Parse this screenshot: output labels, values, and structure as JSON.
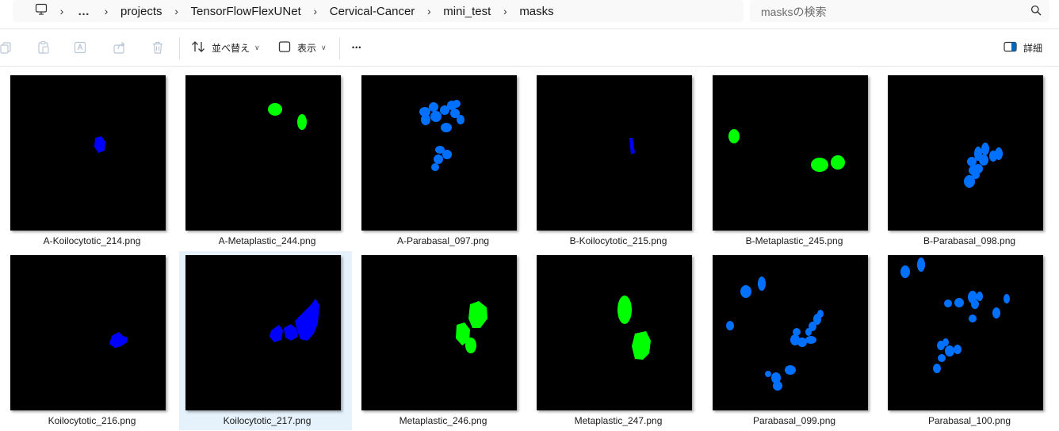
{
  "breadcrumb": {
    "overflow": "…",
    "segments": [
      "projects",
      "TensorFlowFlexUNet",
      "Cervical-Cancer",
      "mini_test",
      "masks"
    ]
  },
  "search": {
    "placeholder": "masksの検索"
  },
  "toolbar": {
    "sort_label": "並べ替え",
    "view_label": "表示",
    "more_label": "•••",
    "details_label": "詳細"
  },
  "colors": {
    "dark_blue": "#0000ff",
    "light_blue": "#0070ff",
    "green": "#00ff00",
    "selection": "#e5f1fb"
  },
  "files": [
    {
      "name": "A-Koilocytotic_214.png"
    },
    {
      "name": "A-Metaplastic_244.png"
    },
    {
      "name": "A-Parabasal_097.png"
    },
    {
      "name": "B-Koilocytotic_215.png"
    },
    {
      "name": "B-Metaplastic_245.png"
    },
    {
      "name": "B-Parabasal_098.png"
    },
    {
      "name": "Koilocytotic_216.png"
    },
    {
      "name": "Koilocytotic_217.png",
      "selected": true
    },
    {
      "name": "Metaplastic_246.png"
    },
    {
      "name": "Metaplastic_247.png"
    },
    {
      "name": "Parabasal_099.png"
    },
    {
      "name": "Parabasal_100.png"
    }
  ]
}
